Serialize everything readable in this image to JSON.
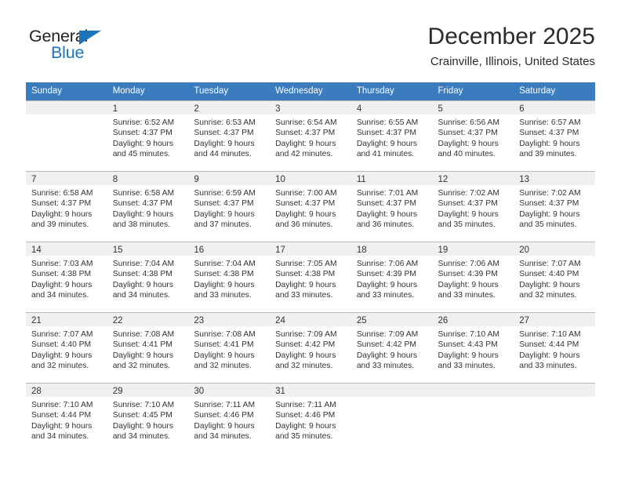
{
  "brand": {
    "name_part1": "General",
    "name_part2": "Blue",
    "accent_color": "#1b75bb"
  },
  "header": {
    "title": "December 2025",
    "subtitle": "Crainville, Illinois, United States"
  },
  "calendar": {
    "header_bg": "#3a7cbe",
    "daynum_bg": "#f0f0f0",
    "weekdays": [
      "Sunday",
      "Monday",
      "Tuesday",
      "Wednesday",
      "Thursday",
      "Friday",
      "Saturday"
    ],
    "weeks": [
      [
        {
          "day": "",
          "sunrise": "",
          "sunset": "",
          "daylight1": "",
          "daylight2": ""
        },
        {
          "day": "1",
          "sunrise": "Sunrise: 6:52 AM",
          "sunset": "Sunset: 4:37 PM",
          "daylight1": "Daylight: 9 hours",
          "daylight2": "and 45 minutes."
        },
        {
          "day": "2",
          "sunrise": "Sunrise: 6:53 AM",
          "sunset": "Sunset: 4:37 PM",
          "daylight1": "Daylight: 9 hours",
          "daylight2": "and 44 minutes."
        },
        {
          "day": "3",
          "sunrise": "Sunrise: 6:54 AM",
          "sunset": "Sunset: 4:37 PM",
          "daylight1": "Daylight: 9 hours",
          "daylight2": "and 42 minutes."
        },
        {
          "day": "4",
          "sunrise": "Sunrise: 6:55 AM",
          "sunset": "Sunset: 4:37 PM",
          "daylight1": "Daylight: 9 hours",
          "daylight2": "and 41 minutes."
        },
        {
          "day": "5",
          "sunrise": "Sunrise: 6:56 AM",
          "sunset": "Sunset: 4:37 PM",
          "daylight1": "Daylight: 9 hours",
          "daylight2": "and 40 minutes."
        },
        {
          "day": "6",
          "sunrise": "Sunrise: 6:57 AM",
          "sunset": "Sunset: 4:37 PM",
          "daylight1": "Daylight: 9 hours",
          "daylight2": "and 39 minutes."
        }
      ],
      [
        {
          "day": "7",
          "sunrise": "Sunrise: 6:58 AM",
          "sunset": "Sunset: 4:37 PM",
          "daylight1": "Daylight: 9 hours",
          "daylight2": "and 39 minutes."
        },
        {
          "day": "8",
          "sunrise": "Sunrise: 6:58 AM",
          "sunset": "Sunset: 4:37 PM",
          "daylight1": "Daylight: 9 hours",
          "daylight2": "and 38 minutes."
        },
        {
          "day": "9",
          "sunrise": "Sunrise: 6:59 AM",
          "sunset": "Sunset: 4:37 PM",
          "daylight1": "Daylight: 9 hours",
          "daylight2": "and 37 minutes."
        },
        {
          "day": "10",
          "sunrise": "Sunrise: 7:00 AM",
          "sunset": "Sunset: 4:37 PM",
          "daylight1": "Daylight: 9 hours",
          "daylight2": "and 36 minutes."
        },
        {
          "day": "11",
          "sunrise": "Sunrise: 7:01 AM",
          "sunset": "Sunset: 4:37 PM",
          "daylight1": "Daylight: 9 hours",
          "daylight2": "and 36 minutes."
        },
        {
          "day": "12",
          "sunrise": "Sunrise: 7:02 AM",
          "sunset": "Sunset: 4:37 PM",
          "daylight1": "Daylight: 9 hours",
          "daylight2": "and 35 minutes."
        },
        {
          "day": "13",
          "sunrise": "Sunrise: 7:02 AM",
          "sunset": "Sunset: 4:37 PM",
          "daylight1": "Daylight: 9 hours",
          "daylight2": "and 35 minutes."
        }
      ],
      [
        {
          "day": "14",
          "sunrise": "Sunrise: 7:03 AM",
          "sunset": "Sunset: 4:38 PM",
          "daylight1": "Daylight: 9 hours",
          "daylight2": "and 34 minutes."
        },
        {
          "day": "15",
          "sunrise": "Sunrise: 7:04 AM",
          "sunset": "Sunset: 4:38 PM",
          "daylight1": "Daylight: 9 hours",
          "daylight2": "and 34 minutes."
        },
        {
          "day": "16",
          "sunrise": "Sunrise: 7:04 AM",
          "sunset": "Sunset: 4:38 PM",
          "daylight1": "Daylight: 9 hours",
          "daylight2": "and 33 minutes."
        },
        {
          "day": "17",
          "sunrise": "Sunrise: 7:05 AM",
          "sunset": "Sunset: 4:38 PM",
          "daylight1": "Daylight: 9 hours",
          "daylight2": "and 33 minutes."
        },
        {
          "day": "18",
          "sunrise": "Sunrise: 7:06 AM",
          "sunset": "Sunset: 4:39 PM",
          "daylight1": "Daylight: 9 hours",
          "daylight2": "and 33 minutes."
        },
        {
          "day": "19",
          "sunrise": "Sunrise: 7:06 AM",
          "sunset": "Sunset: 4:39 PM",
          "daylight1": "Daylight: 9 hours",
          "daylight2": "and 33 minutes."
        },
        {
          "day": "20",
          "sunrise": "Sunrise: 7:07 AM",
          "sunset": "Sunset: 4:40 PM",
          "daylight1": "Daylight: 9 hours",
          "daylight2": "and 32 minutes."
        }
      ],
      [
        {
          "day": "21",
          "sunrise": "Sunrise: 7:07 AM",
          "sunset": "Sunset: 4:40 PM",
          "daylight1": "Daylight: 9 hours",
          "daylight2": "and 32 minutes."
        },
        {
          "day": "22",
          "sunrise": "Sunrise: 7:08 AM",
          "sunset": "Sunset: 4:41 PM",
          "daylight1": "Daylight: 9 hours",
          "daylight2": "and 32 minutes."
        },
        {
          "day": "23",
          "sunrise": "Sunrise: 7:08 AM",
          "sunset": "Sunset: 4:41 PM",
          "daylight1": "Daylight: 9 hours",
          "daylight2": "and 32 minutes."
        },
        {
          "day": "24",
          "sunrise": "Sunrise: 7:09 AM",
          "sunset": "Sunset: 4:42 PM",
          "daylight1": "Daylight: 9 hours",
          "daylight2": "and 32 minutes."
        },
        {
          "day": "25",
          "sunrise": "Sunrise: 7:09 AM",
          "sunset": "Sunset: 4:42 PM",
          "daylight1": "Daylight: 9 hours",
          "daylight2": "and 33 minutes."
        },
        {
          "day": "26",
          "sunrise": "Sunrise: 7:10 AM",
          "sunset": "Sunset: 4:43 PM",
          "daylight1": "Daylight: 9 hours",
          "daylight2": "and 33 minutes."
        },
        {
          "day": "27",
          "sunrise": "Sunrise: 7:10 AM",
          "sunset": "Sunset: 4:44 PM",
          "daylight1": "Daylight: 9 hours",
          "daylight2": "and 33 minutes."
        }
      ],
      [
        {
          "day": "28",
          "sunrise": "Sunrise: 7:10 AM",
          "sunset": "Sunset: 4:44 PM",
          "daylight1": "Daylight: 9 hours",
          "daylight2": "and 34 minutes."
        },
        {
          "day": "29",
          "sunrise": "Sunrise: 7:10 AM",
          "sunset": "Sunset: 4:45 PM",
          "daylight1": "Daylight: 9 hours",
          "daylight2": "and 34 minutes."
        },
        {
          "day": "30",
          "sunrise": "Sunrise: 7:11 AM",
          "sunset": "Sunset: 4:46 PM",
          "daylight1": "Daylight: 9 hours",
          "daylight2": "and 34 minutes."
        },
        {
          "day": "31",
          "sunrise": "Sunrise: 7:11 AM",
          "sunset": "Sunset: 4:46 PM",
          "daylight1": "Daylight: 9 hours",
          "daylight2": "and 35 minutes."
        },
        {
          "day": "",
          "sunrise": "",
          "sunset": "",
          "daylight1": "",
          "daylight2": ""
        },
        {
          "day": "",
          "sunrise": "",
          "sunset": "",
          "daylight1": "",
          "daylight2": ""
        },
        {
          "day": "",
          "sunrise": "",
          "sunset": "",
          "daylight1": "",
          "daylight2": ""
        }
      ]
    ]
  }
}
